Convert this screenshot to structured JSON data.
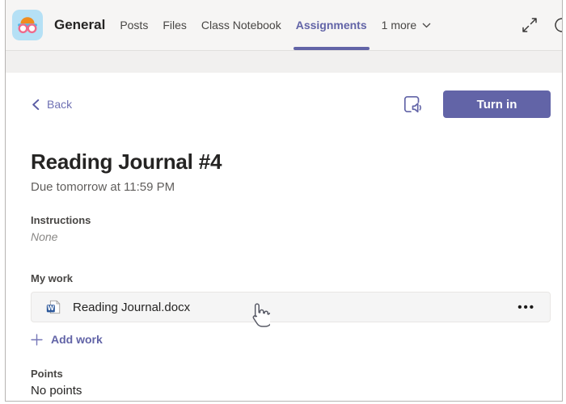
{
  "colors": {
    "accent_purple": "#6264a7",
    "word_blue": "#2b579a",
    "avatar_bg": "#b5e0f5",
    "avatar_cap_orange": "#f08c1e",
    "goggle_pink": "#ef6a8b",
    "goggle_blue": "#4db8e8",
    "card_bg": "#f5f5f5",
    "band_gray": "#f1f0ef",
    "text_dark": "#252423",
    "text_gray": "#605e5c"
  },
  "header": {
    "channel_name": "General",
    "tabs": [
      {
        "label": "Posts",
        "active": false
      },
      {
        "label": "Files",
        "active": false
      },
      {
        "label": "Class Notebook",
        "active": false
      },
      {
        "label": "Assignments",
        "active": true
      }
    ],
    "more_tabs": {
      "label": "1 more"
    }
  },
  "toolbar": {
    "back_label": "Back",
    "turn_in_label": "Turn in"
  },
  "assignment": {
    "title": "Reading Journal #4",
    "due": "Due tomorrow at 11:59 PM",
    "instructions": {
      "label": "Instructions",
      "value": "None"
    },
    "my_work": {
      "label": "My work",
      "attachment": {
        "file_name": "Reading Journal.docx",
        "file_type": "Word document"
      },
      "add_work_label": "Add work"
    },
    "points": {
      "label": "Points",
      "value": "No points"
    }
  },
  "icons": {
    "more_options": "•••"
  }
}
